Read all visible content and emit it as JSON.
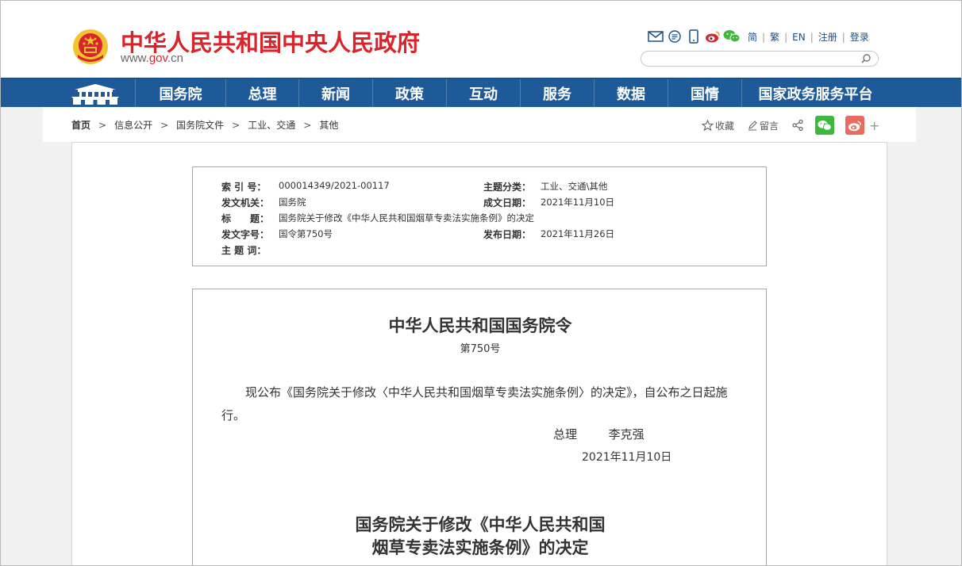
{
  "site": {
    "title": "中华人民共和国中央人民政府",
    "url_prefix": "www.",
    "url_domain": "gov",
    "url_suffix": ".cn"
  },
  "top_links": [
    "简",
    "繁",
    "EN",
    "注册",
    "登录"
  ],
  "search": {
    "placeholder": ""
  },
  "nav": {
    "items": [
      "国务院",
      "总理",
      "新闻",
      "政策",
      "互动",
      "服务",
      "数据",
      "国情",
      "国家政务服务平台"
    ]
  },
  "breadcrumb": [
    "首页",
    "信息公开",
    "国务院文件",
    "工业、交通",
    "其他"
  ],
  "share": {
    "collect": "收藏",
    "comment": "留言"
  },
  "meta": {
    "index_label": "索 引 号：",
    "index_value": "000014349/2021-00117",
    "category_label": "主题分类：",
    "category_value": "工业、交通\\其他",
    "issuer_label": "发文机关：",
    "issuer_value": "国务院",
    "date_written_label": "成文日期：",
    "date_written_value": "2021年11月10日",
    "title_label": "标　　题：",
    "title_value": "国务院关于修改《中华人民共和国烟草专卖法实施条例》的决定",
    "doc_no_label": "发文字号：",
    "doc_no_value": "国令第750号",
    "publish_date_label": "发布日期：",
    "publish_date_value": "2021年11月26日",
    "keywords_label": "主 题 词：",
    "keywords_value": ""
  },
  "doc": {
    "title": "中华人民共和国国务院令",
    "number": "第750号",
    "paragraph": "现公布《国务院关于修改〈中华人民共和国烟草专卖法实施条例〉的决定》，自公布之日起施行。",
    "signer_role": "总理",
    "signer_name": "李克强",
    "sign_date": "2021年11月10日",
    "subtitle_line1": "国务院关于修改《中华人民共和国",
    "subtitle_line2": "烟草专卖法实施条例》的决定"
  },
  "colors": {
    "brand_red": "#d8242a",
    "nav_blue": "#1d5a97",
    "wechat_green": "#3fb73c",
    "weibo_pink": "#e96a5e"
  }
}
